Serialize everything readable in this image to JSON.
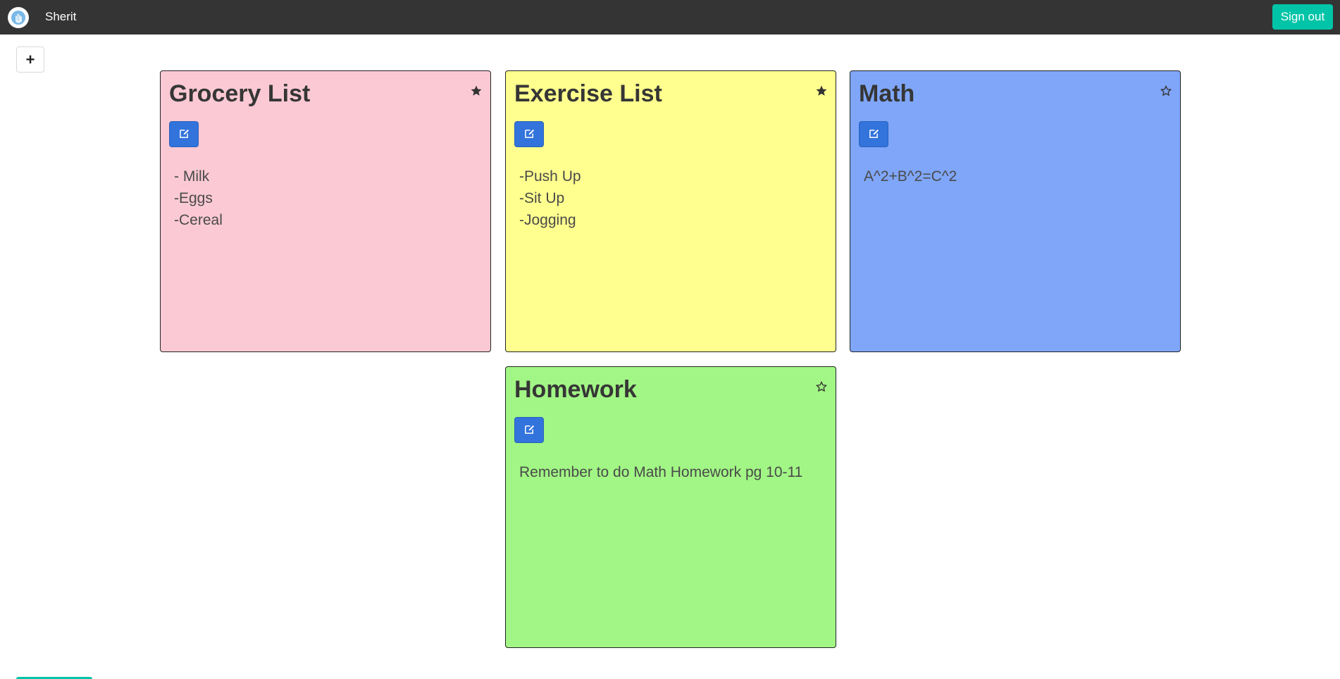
{
  "navbar": {
    "logo_icon": "hand-logo-icon",
    "brand": "Sherit",
    "signout_label": "Sign out",
    "signout_color": "#00c4a7"
  },
  "toolbar": {
    "add_label": "+"
  },
  "notes": [
    {
      "title": "Grocery List",
      "favorited": true,
      "color": "#fbc9d4",
      "lines": [
        "- Milk",
        "-Eggs",
        "-Cereal"
      ]
    },
    {
      "title": "Exercise List",
      "favorited": true,
      "color": "#ffff8f",
      "lines": [
        "-Push Up",
        "-Sit Up",
        "-Jogging"
      ]
    },
    {
      "title": "Math",
      "favorited": false,
      "color": "#7fa6f8",
      "lines": [
        "A^2+B^2=C^2"
      ]
    },
    {
      "title": "Homework",
      "favorited": false,
      "color": "#a2f685",
      "lines": [
        "Remember to do Math Homework pg 10-11"
      ]
    }
  ],
  "colors": {
    "navbar_bg": "#343434",
    "edit_button": "#3273dc"
  }
}
